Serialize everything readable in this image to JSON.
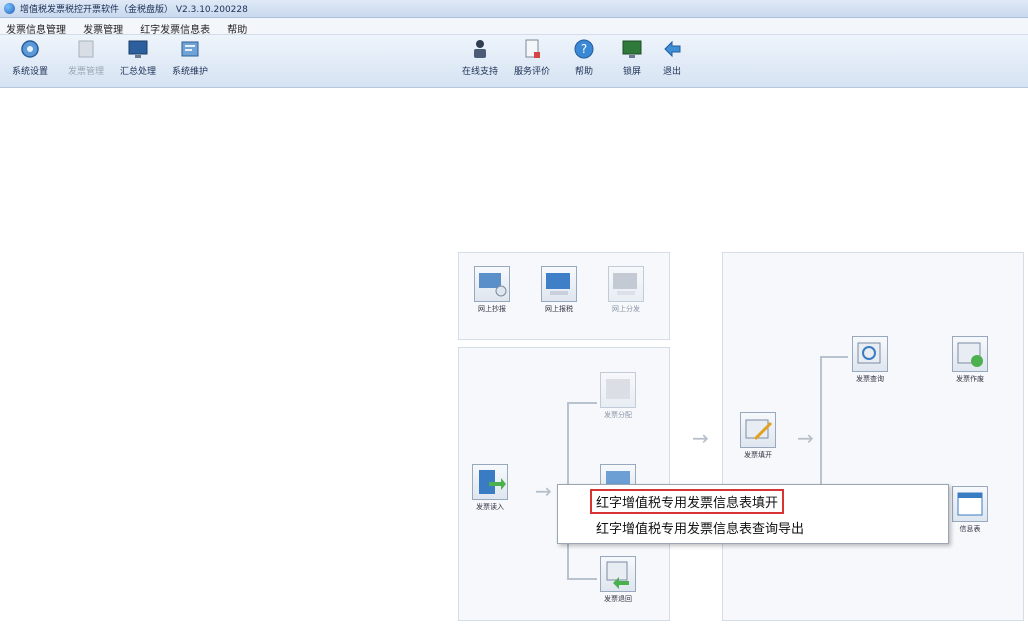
{
  "window": {
    "title": "增值税发票税控开票软件（金税盘版） V2.3.10.200228"
  },
  "menu": [
    "发票信息管理",
    "发票管理",
    "红字发票信息表",
    "帮助"
  ],
  "toolbar_left": [
    {
      "label": "系统设置",
      "icon": "gear-icon"
    },
    {
      "label": "发票管理",
      "icon": "invoice-icon",
      "disabled": true
    },
    {
      "label": "汇总处理",
      "icon": "monitor-icon"
    },
    {
      "label": "系统维护",
      "icon": "maintenance-icon"
    }
  ],
  "toolbar_right": [
    {
      "label": "在线支持",
      "icon": "person-icon"
    },
    {
      "label": "服务评价",
      "icon": "document-icon"
    },
    {
      "label": "帮助",
      "icon": "help-icon"
    },
    {
      "label": "锁屏",
      "icon": "lock-screen-icon"
    },
    {
      "label": "退出",
      "icon": "exit-icon"
    }
  ],
  "flow_top": [
    {
      "label": "网上抄报"
    },
    {
      "label": "网上报税"
    },
    {
      "label": "网上分发",
      "disabled": true
    }
  ],
  "flow_left": {
    "read_in": "发票读入",
    "split": "发票分配",
    "return": "发票退回"
  },
  "flow_right": {
    "fill": "发票填开",
    "query": "发票查询",
    "void": "发票作废",
    "info_table": "信息表"
  },
  "context_menu": [
    {
      "label": "红字增值税专用发票信息表填开",
      "selected": true
    },
    {
      "label": "红字增值税专用发票信息表查询导出"
    }
  ]
}
